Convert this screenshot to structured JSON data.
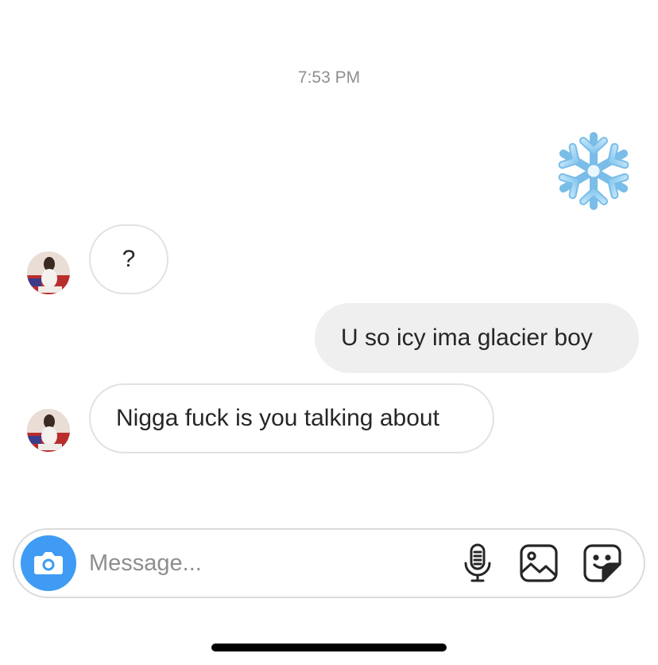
{
  "conversation": {
    "timestamp": "7:53 PM",
    "messages": [
      {
        "sender": "me",
        "kind": "sticker",
        "icon": "snowflake-icon"
      },
      {
        "sender": "them",
        "kind": "text",
        "text": "?"
      },
      {
        "sender": "me",
        "kind": "text",
        "text": "U so icy ima glacier boy"
      },
      {
        "sender": "them",
        "kind": "text",
        "text": "Nigga fuck is you talking about"
      }
    ]
  },
  "composer": {
    "placeholder": "Message...",
    "value": "",
    "camera_icon": "camera-icon",
    "tools": [
      "microphone-icon",
      "gallery-icon",
      "sticker-icon"
    ]
  },
  "colors": {
    "incoming_border": "#e2e2e2",
    "outgoing_bg": "#efefef",
    "camera_button": "#3f9bf3",
    "meta_text": "#8e8e8e"
  }
}
